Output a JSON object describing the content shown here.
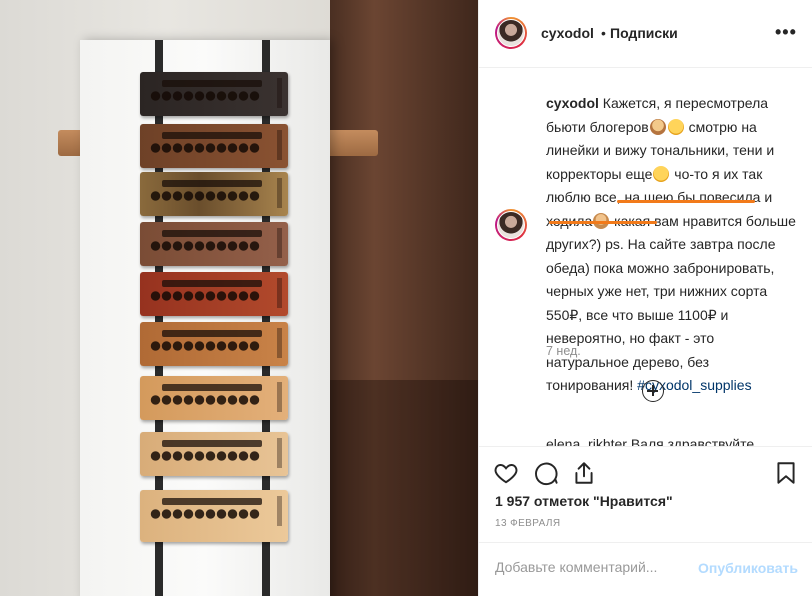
{
  "post": {
    "username": "cyxodol",
    "dot": "•",
    "follow_status": "Подписки",
    "more": "•••",
    "caption_user": "cyxodol",
    "caption_parts": {
      "p1": " Кажется, я пересмотрела бьюти блогеров",
      "p2": " смотрю на линейки и вижу тональники, тени и корректоры еще",
      "p3": " чо-то я их так люблю все, на шею бы повесила и ходила",
      "p4": " какая вам нравится больше других?)",
      "p5": " ps. На сайте завтра после обеда) пока можно забронировать, черных уже нет, три нижних сорта 550₽, все что выше 1100₽ и невероятно, но факт - это натуральное дерево, без тонирования! ",
      "hashtag": "#cyxodol_supplies"
    },
    "time_ago": "7 нед.",
    "next_comment": "elena_rikhter Валя здравствуйте",
    "likes": "1 957 отметок \"Нравится\"",
    "date": "13 ФЕВРАЛЯ",
    "comment_placeholder": "Добавьте комментарий...",
    "publish": "Опубликовать"
  },
  "icons": [
    "like-icon",
    "comment-icon",
    "share-icon",
    "save-icon",
    "more-icon",
    "load-more-icon"
  ],
  "colors": {
    "link": "#003569",
    "highlight": "#f27a1a",
    "publish_disabled": "#b3dbff",
    "muted": "#8e8e8e"
  }
}
